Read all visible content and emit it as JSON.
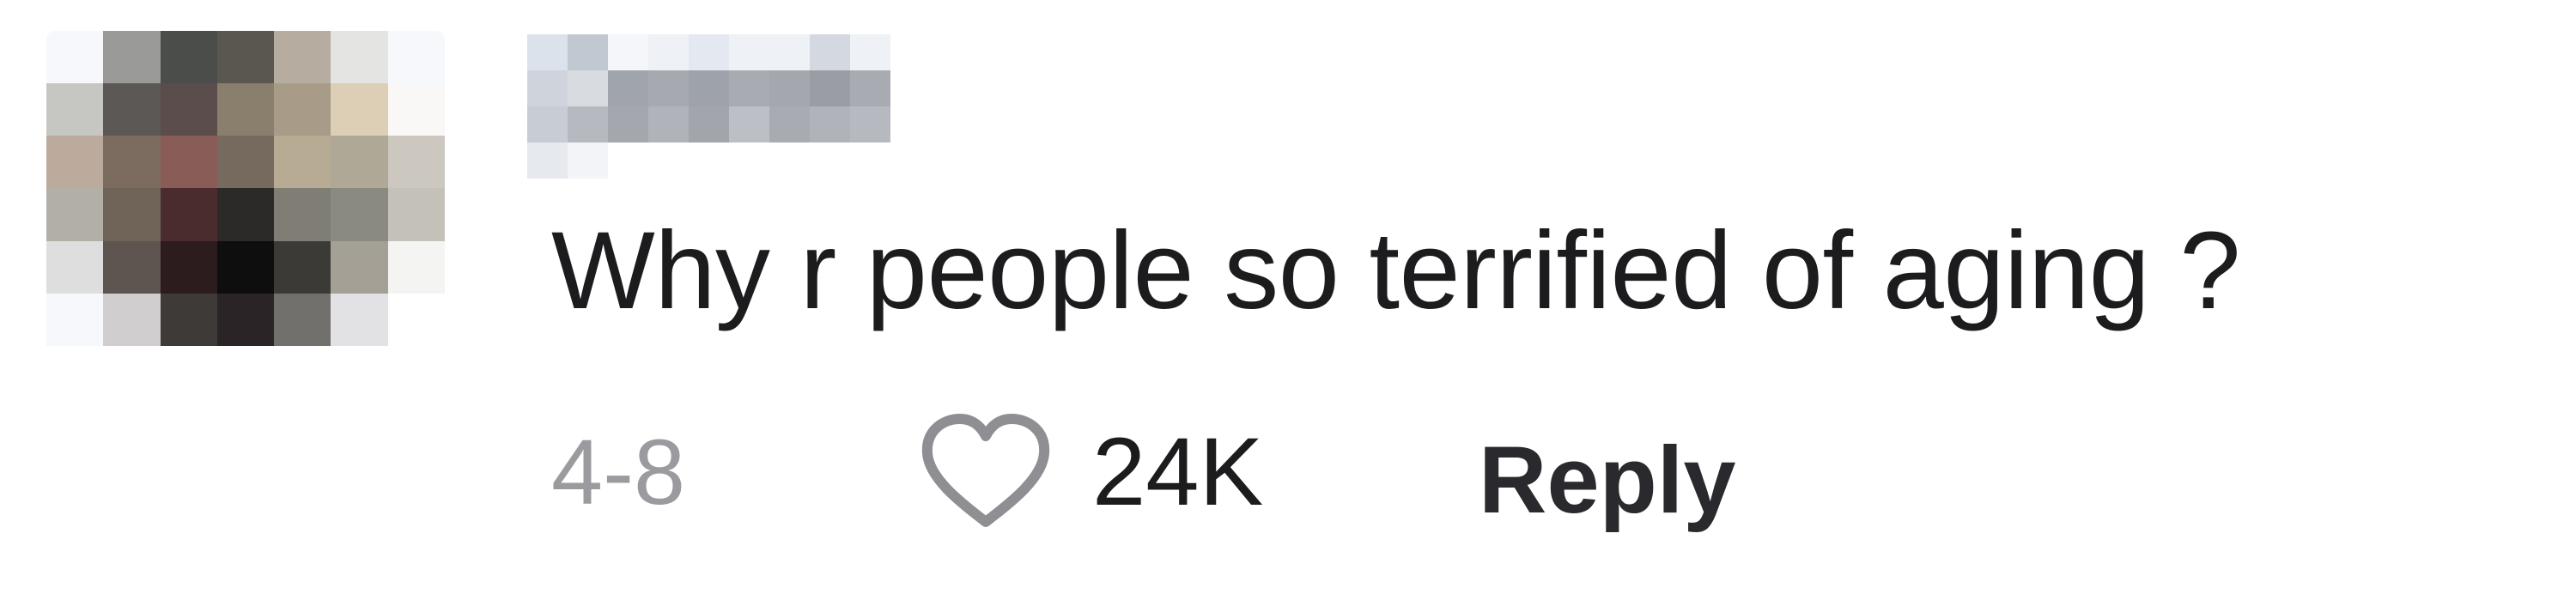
{
  "comment": {
    "text": "Why r people so terrified of aging ?",
    "date": "4-8",
    "likes": "24K",
    "reply_label": "Reply",
    "heart_icon": "heart-outline-icon"
  },
  "avatar": {
    "style": "pixelated",
    "palette": [
      "#f6f8fc",
      "#9a9a98",
      "#4a4d49",
      "#5a5750",
      "#b6aca0",
      "#e4e4e2",
      "#f6f8fc",
      "#c6c6c2",
      "#5c5856",
      "#5a4d4c",
      "#8a7e6c",
      "#a89c88",
      "#dccfb6",
      "#faf8f6",
      "#bcaa9c",
      "#7c6c60",
      "#8a5c58",
      "#766a5e",
      "#b8ab94",
      "#b0a896",
      "#ccc8c0",
      "#b2afa6",
      "#706458",
      "#4a2c2e",
      "#2c2a28",
      "#807e74",
      "#8a8a80",
      "#c4c2b8",
      "#dedede",
      "#5e5450",
      "#2c1c1e",
      "#0e0e0e",
      "#3c3a36",
      "#a4a096",
      "#f4f4f2",
      "#f6f8fc",
      "#d0cece",
      "#3e3a38",
      "#2a2426",
      "#72706c",
      "#e2e2e4",
      "#ffffff",
      "#ffffff",
      "#ffffff",
      "#ffffff",
      "#ffffff",
      "#ffffff",
      "#ffffff",
      "#ffffff"
    ]
  },
  "username": {
    "style": "pixelated",
    "palette": [
      "#dbe2ec",
      "#c2c8d2",
      "#f4f6fa",
      "#eef1f6",
      "#e4e8f0",
      "#eef1f6",
      "#eef1f6",
      "#d4d8e0",
      "#eef1f6",
      "#ffffff",
      "#cfd4dc",
      "#d8dbe0",
      "#a0a4ac",
      "#a6a9b0",
      "#9ea2aa",
      "#a8abb2",
      "#a4a7ae",
      "#9a9da4",
      "#a8abb2",
      "#ffffff",
      "#c8ccd4",
      "#b6b9c0",
      "#a4a7ae",
      "#b0b3ba",
      "#a2a5ac",
      "#bcbfc6",
      "#a8abb2",
      "#b0b3ba",
      "#b6b9c0",
      "#ffffff",
      "#e6e9ee",
      "#f2f4f8",
      "#ffffff",
      "#ffffff",
      "#ffffff",
      "#ffffff",
      "#ffffff",
      "#ffffff",
      "#ffffff",
      "#ffffff"
    ]
  }
}
